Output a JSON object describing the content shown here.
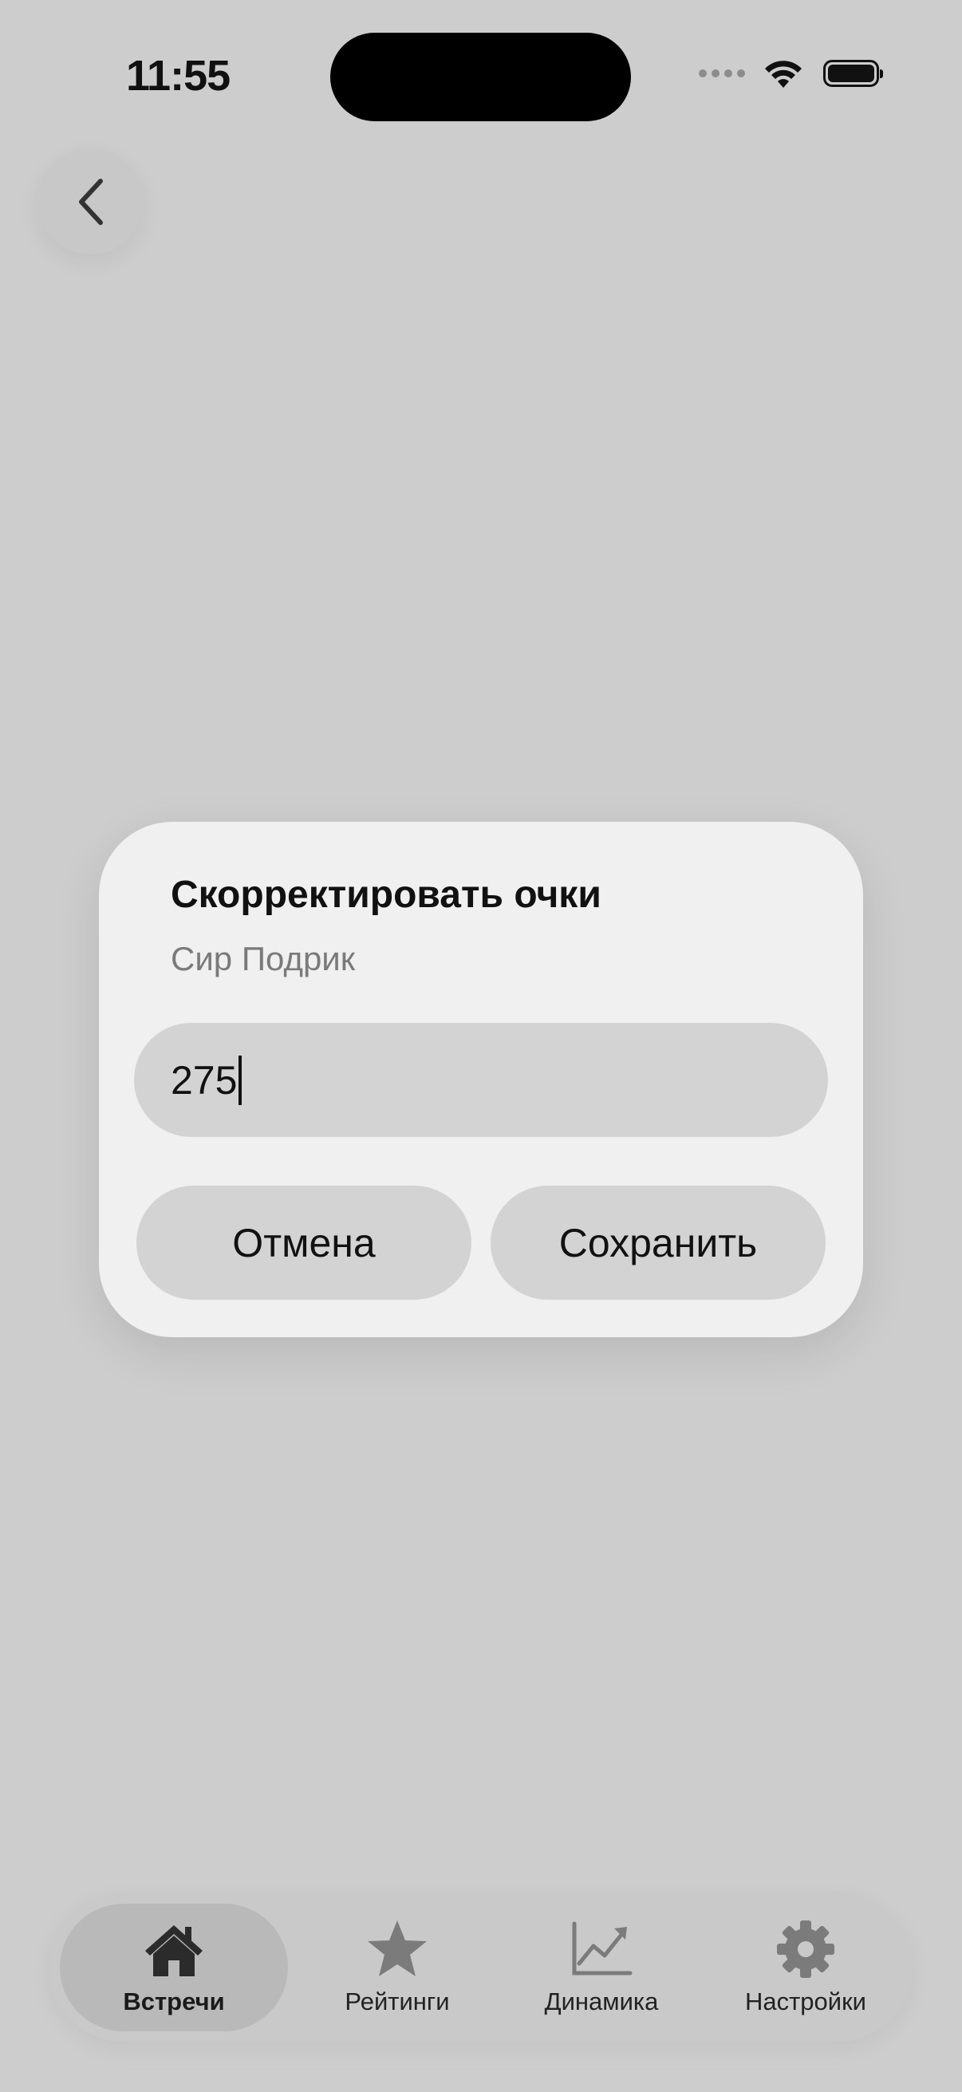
{
  "status_bar": {
    "time": "11:55"
  },
  "dialog": {
    "title": "Скорректировать очки",
    "subtitle": "Сир Подрик",
    "input_value": "275",
    "cancel_label": "Отмена",
    "save_label": "Сохранить"
  },
  "tab_bar": {
    "items": [
      {
        "label": "Встречи",
        "icon": "house-icon",
        "active": true
      },
      {
        "label": "Рейтинги",
        "icon": "star-icon",
        "active": false
      },
      {
        "label": "Динамика",
        "icon": "chart-line-icon",
        "active": false
      },
      {
        "label": "Настройки",
        "icon": "gear-icon",
        "active": false
      }
    ]
  },
  "colors": {
    "background": "#cdcdcd",
    "dialog": "#f0f0f0",
    "field": "#d3d3d3",
    "text": "#111111",
    "subtext": "#7a7a7a"
  }
}
